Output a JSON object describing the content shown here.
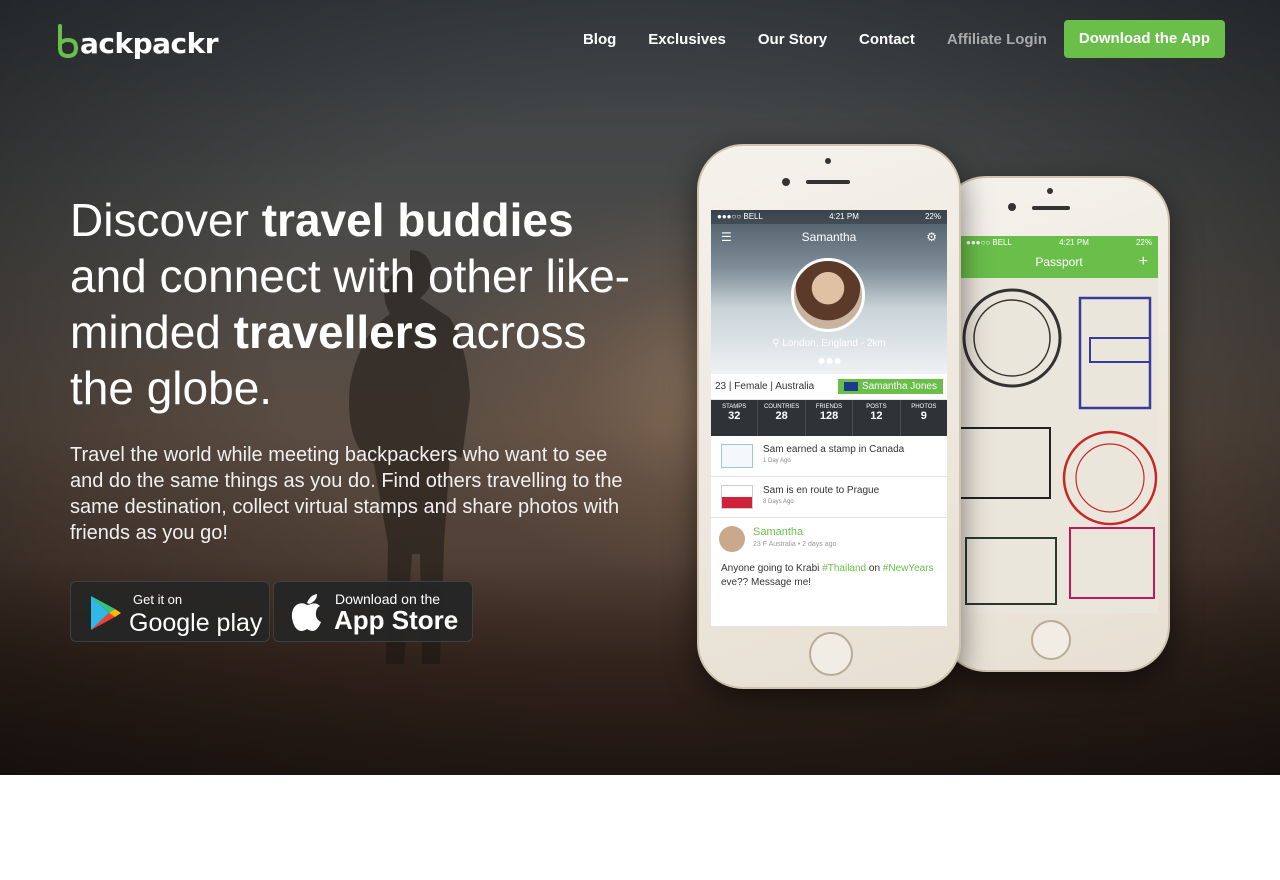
{
  "brand": {
    "logo_text": "backpackr",
    "accent": "#6abf4b"
  },
  "nav": {
    "links": [
      "Blog",
      "Exclusives",
      "Our Story",
      "Contact"
    ],
    "affiliate": "Affiliate Login",
    "cta": "Download the App"
  },
  "hero": {
    "h_part1": "Discover ",
    "h_bold1": "travel buddies",
    "h_part2": " and connect with other like-minded ",
    "h_bold2": "travellers",
    "h_part3": " across the globe.",
    "subtitle": "Travel the world while meeting backpackers who want to see and do the same things as you do. Find others travelling to the same destination, collect virtual stamps and share photos with friends as you go!"
  },
  "stores": {
    "google": {
      "line1": "Get it on",
      "line2": "Google play"
    },
    "apple": {
      "line1": "Download on the",
      "line2": "App Store"
    }
  },
  "phone_back": {
    "carrier": "●●●○○ BELL",
    "time": "4:21 PM",
    "battery": "22%",
    "title": "Passport",
    "plus": "+"
  },
  "phone_front": {
    "carrier": "●●●○○ BELL",
    "time": "4:21 PM",
    "battery": "22%",
    "title": "Samantha",
    "location": "London, England - 2km",
    "dots": "●●●",
    "info": "23  |  Female  |  Australia",
    "badge": "Samantha Jones",
    "stats": [
      {
        "k": "STAMPS",
        "v": "32"
      },
      {
        "k": "COUNTRIES",
        "v": "28"
      },
      {
        "k": "FRIENDS",
        "v": "128"
      },
      {
        "k": "POSTS",
        "v": "12"
      },
      {
        "k": "PHOTOS",
        "v": "9"
      }
    ],
    "feed": [
      {
        "text": "Sam earned a stamp in Canada",
        "date": "1 Day Ago"
      },
      {
        "text": "Sam is en route to Prague",
        "date": "8 Days Ago"
      }
    ],
    "post": {
      "name": "Samantha",
      "meta": "23 F Australia   •   2 days ago",
      "text1": "Anyone going to Krabi ",
      "tag1": "#Thailand",
      "text2": " on ",
      "tag2": "#NewYears",
      "text3": " eve?? Message me!"
    }
  }
}
